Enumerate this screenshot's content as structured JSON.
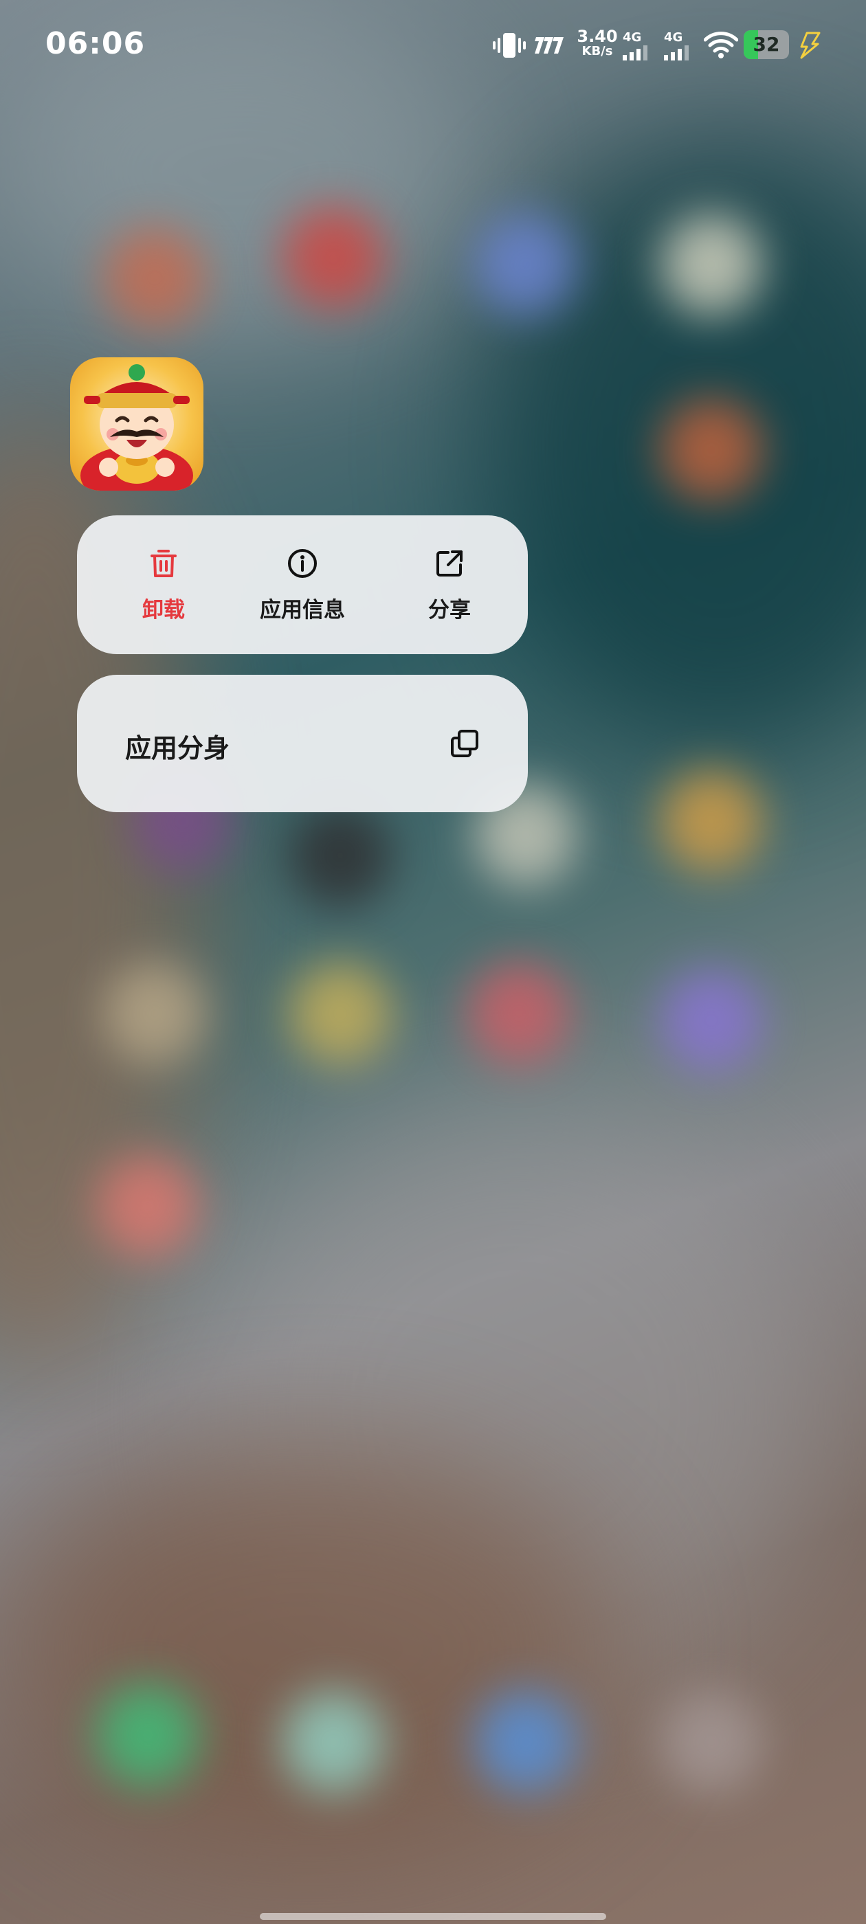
{
  "status_bar": {
    "time": "06:06",
    "net_speed_value": "3.40",
    "net_speed_unit": "KB/s",
    "hd_label": "7777",
    "sim1_label": "4G",
    "sim2_label": "4G",
    "battery_level": "32",
    "battery_fill_percent": 32,
    "icons": [
      "vibrate-icon",
      "hd-voice-icon",
      "signal-icon",
      "signal-icon",
      "wifi-icon",
      "battery-icon",
      "charging-icon"
    ]
  },
  "app": {
    "icon": "god-of-wealth-app-icon"
  },
  "context_menu": {
    "actions": [
      {
        "label": "卸载",
        "icon": "trash-icon",
        "color": "#e5393e"
      },
      {
        "label": "应用信息",
        "icon": "info-icon"
      },
      {
        "label": "分享",
        "icon": "share-icon"
      }
    ],
    "clone": {
      "label": "应用分身",
      "icon": "clone-icon"
    }
  },
  "colors": {
    "accent_red": "#e5393e",
    "battery_green": "#36c75a",
    "card_bg": "#eef0f2"
  }
}
